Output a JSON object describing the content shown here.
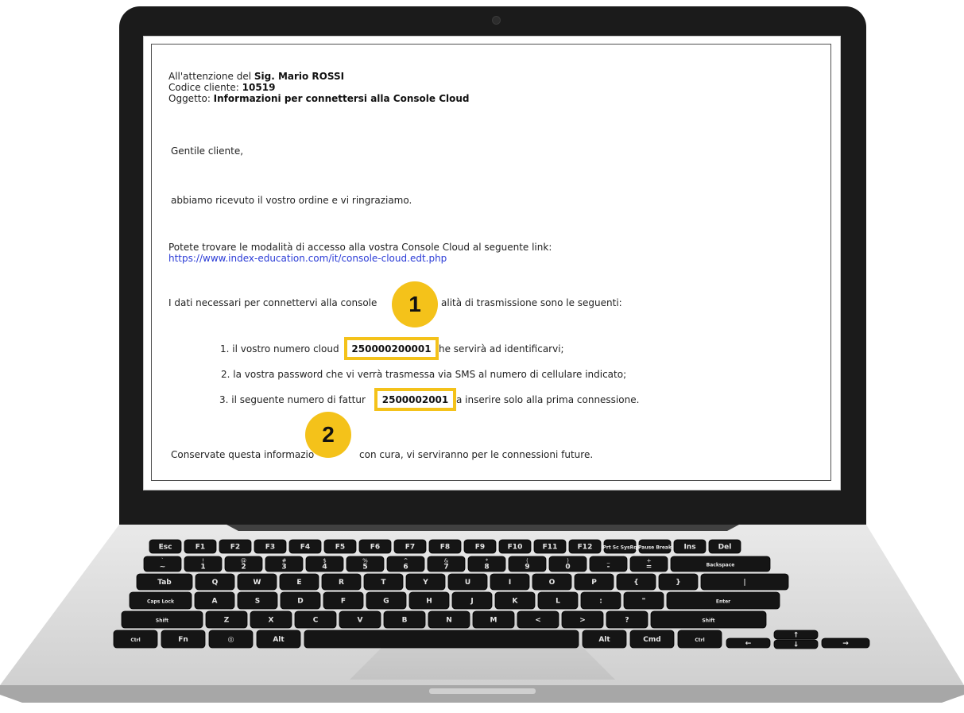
{
  "letter": {
    "greeting_prefix": "All'attenzione del ",
    "recipient": "Sig. Mario ROSSI",
    "client_code_label": "Codice cliente: ",
    "client_code": "10519",
    "subject_label": "Oggetto: ",
    "subject": "Informazioni per connettersi alla Console Cloud",
    "salutation": "Gentile cliente,",
    "thanks": "abbiamo ricevuto il vostro ordine e vi ringraziamo.",
    "access_text": "Potete trovare le modalità di accesso alla vostra Console Cloud al seguente link:",
    "access_link": "https://www.index-education.com/it/console-cloud.edt.php",
    "data_intro_a": "I dati necessari per connettervi alla console",
    "data_intro_b": "alità di trasmissione sono le seguenti:",
    "item1_a": "1. il vostro numero cloud",
    "item1_b": "he servirà ad identificarvi;",
    "item2": "2. la vostra password che vi verrà trasmessa via SMS al numero di cellulare indicato;",
    "item3_a": "3. il seguente numero di fattur",
    "item3_b": "a inserire solo alla prima connessione.",
    "closing_a": "Conservate questa informazio",
    "closing_b": "con cura, vi serviranno per le connessioni future."
  },
  "highlights": {
    "cloud_number": "250000200001",
    "invoice_number": "2500002001",
    "color": "#f4c21a"
  },
  "badges": {
    "one": "1",
    "two": "2"
  },
  "keyboard": {
    "row1": [
      "Esc",
      "F1",
      "F2",
      "F3",
      "F4",
      "F5",
      "F6",
      "F7",
      "F8",
      "F9",
      "F10",
      "F11",
      "F12",
      "Prt Sc SysRq",
      "Pause Break",
      "Ins",
      "Del"
    ],
    "row2": [
      "~",
      "1",
      "2",
      "3",
      "4",
      "5",
      "6",
      "7",
      "8",
      "9",
      "0",
      "-",
      "=",
      "Backspace"
    ],
    "row2_shift": [
      "`",
      "!",
      "@",
      "#",
      "$",
      "%",
      "^",
      "&",
      "*",
      "(",
      ")",
      "_",
      "+"
    ],
    "row3": [
      "Tab",
      "Q",
      "W",
      "E",
      "R",
      "T",
      "Y",
      "U",
      "I",
      "O",
      "P",
      "{",
      "}",
      "|"
    ],
    "row4": [
      "Caps Lock",
      "A",
      "S",
      "D",
      "F",
      "G",
      "H",
      "J",
      "K",
      "L",
      ":",
      "\"",
      "Enter"
    ],
    "row5": [
      "Shift",
      "Z",
      "X",
      "C",
      "V",
      "B",
      "N",
      "M",
      "<",
      ">",
      "?",
      "Shift"
    ],
    "row6": [
      "Ctrl",
      "Fn",
      "Alt",
      "Alt",
      "Cmd",
      "Ctrl"
    ]
  }
}
